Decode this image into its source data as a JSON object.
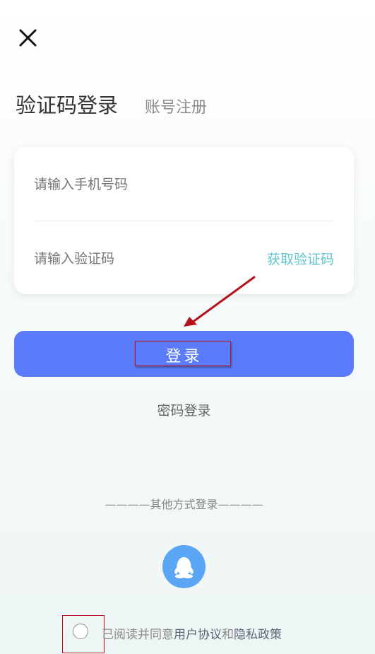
{
  "header": {
    "tab_active": "验证码登录",
    "tab_inactive": "账号注册"
  },
  "form": {
    "phone_placeholder": "请输入手机号码",
    "code_placeholder": "请输入验证码",
    "get_code_label": "获取验证码"
  },
  "buttons": {
    "login_label": "登录",
    "password_login_label": "密码登录"
  },
  "other": {
    "label": "————其他方式登录————",
    "icons": [
      "qq-icon"
    ]
  },
  "agreement": {
    "prefix": "已阅读并同意",
    "user_agreement": "用户协议",
    "conjunction": "和",
    "privacy_policy": "隐私政策"
  },
  "colors": {
    "primary": "#5b7cfa",
    "accent_teal": "#5fc4cf",
    "qq_blue": "#5ba5f5",
    "annotation_red": "#c0101a"
  }
}
